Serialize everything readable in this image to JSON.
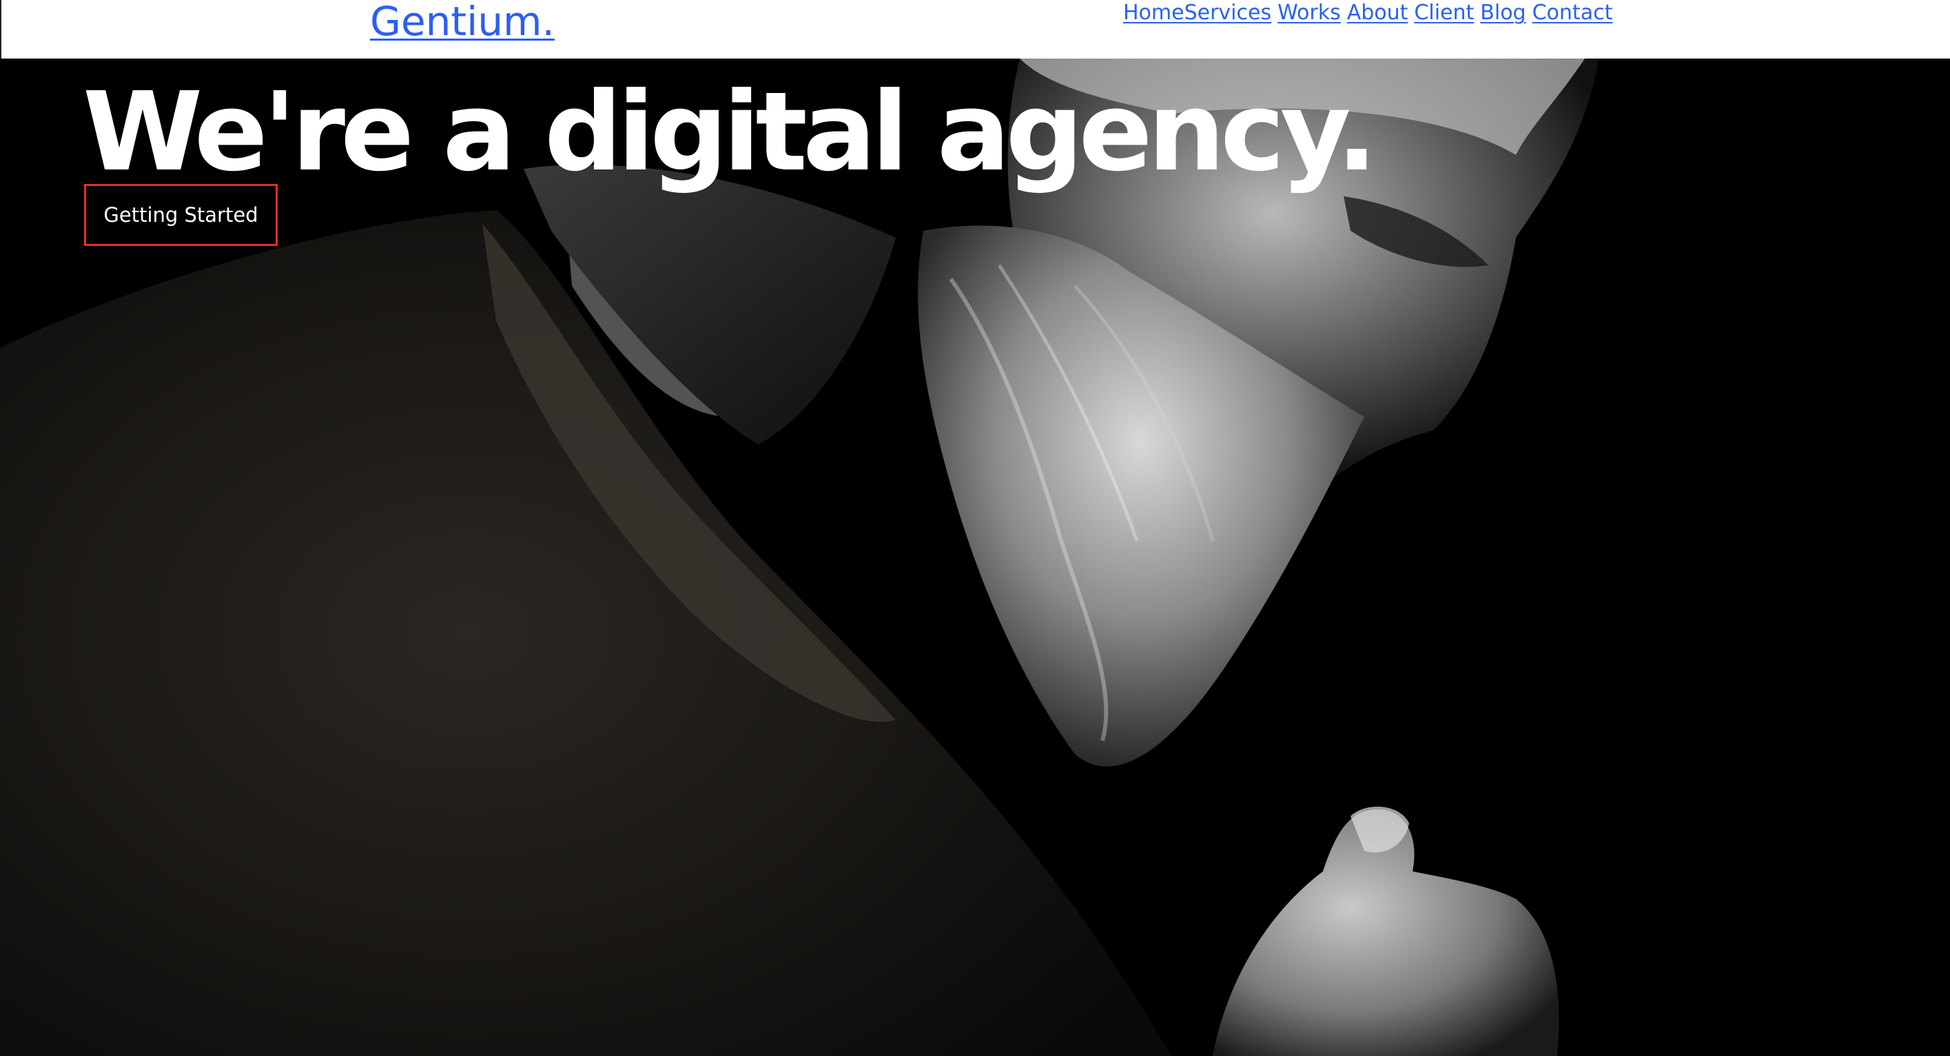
{
  "header": {
    "logo": "Gentium.",
    "nav": [
      {
        "label": "Home"
      },
      {
        "label": "Services"
      },
      {
        "label": "Works"
      },
      {
        "label": "About"
      },
      {
        "label": "Client"
      },
      {
        "label": "Blog"
      },
      {
        "label": "Contact"
      }
    ]
  },
  "hero": {
    "headline": "We're a digital agency.",
    "cta_label": "Getting Started",
    "background": "black-and-white-portrait-bearded-man"
  },
  "colors": {
    "link": "#2b5ff0",
    "cta_border": "#e0331f",
    "hero_bg": "#000000",
    "text": "#ffffff"
  }
}
